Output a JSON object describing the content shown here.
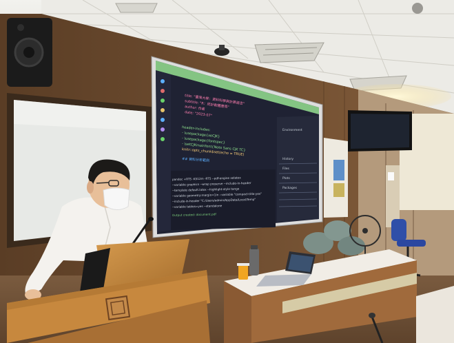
{
  "scene": {
    "description_type": "photograph",
    "colors": {
      "ceiling": "#e9e9e4",
      "wall_wood": "#6a4a2e",
      "screen": "#1e1e2e",
      "code_green": "#6adf6a",
      "podium_wood": "#c98a3e",
      "shirt": "#f4f2ee",
      "desk_top": "#f1ede6",
      "desk_wood": "#8a5a33",
      "mask": "#f7f7f7",
      "chairs": "#7c8f88"
    }
  },
  "screen": {
    "code_lines": [
      "title: \"臺灣大學：資料科學與計算語言\"",
      "subtitle: \"R：統計軟體應用\"",
      "author: 作者",
      "date: \"2023-07\"",
      "",
      "header-includes:",
      "  - \\usepackage{xeCJK}",
      "  - \\usepackage{fontspec}",
      "  - \\setCJKmainfont{Noto Sans CJK TC}",
      "knitr::opts_chunk$set(echo = TRUE)",
      "",
      "## 資料分析範例"
    ],
    "console_lines": [
      "pandoc +RTS -K512m -RTS --pdf-engine xelatex",
      "--variable graphics --wrap preserve --include-in-header",
      "--template default.latex --highlight-style tango",
      "--variable geometry:margin=1in --variable \"compact-title:yes\"",
      "--include-in-header \"C:/Users/admin/AppData/Local/Temp\"",
      "--variable tables=yes --standalone",
      "Output created: document.pdf"
    ],
    "right_panel_lines": [
      "Environment",
      "History",
      "Files",
      "Plots",
      "Packages"
    ]
  }
}
